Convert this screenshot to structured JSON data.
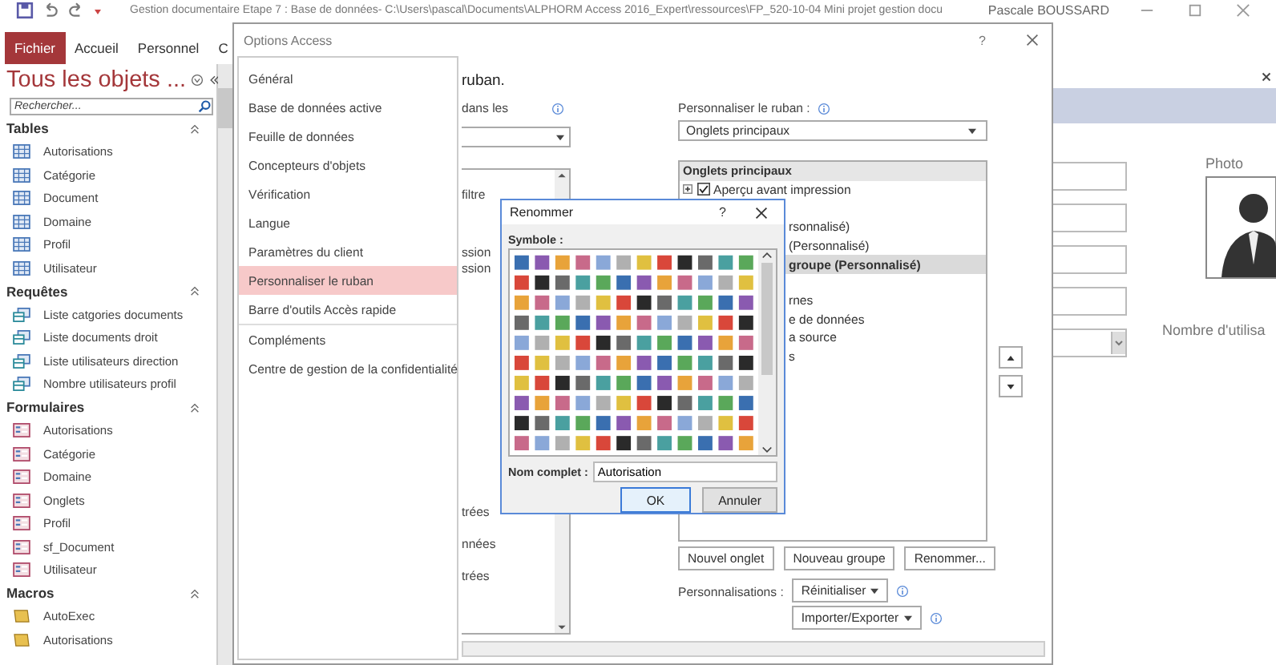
{
  "title_bar": {
    "title": "Gestion documentaire Etape 7 : Base de données- C:\\Users\\pascal\\Documents\\ALPHORM Access 2016_Expert\\ressources\\FP_520-10-04 Mini projet gestion docu",
    "user": "Pascale BOUSSARD"
  },
  "ribbon_tabs": [
    {
      "label": "Fichier",
      "selected": true
    },
    {
      "label": "Accueil",
      "selected": false
    },
    {
      "label": "Personnel",
      "selected": false
    },
    {
      "label": "C",
      "selected": false
    }
  ],
  "navigation": {
    "title": "Tous les objets ...",
    "search": {
      "placeholder": "Rechercher..."
    },
    "groups": [
      {
        "label": "Tables",
        "kind": "table",
        "items": [
          "Autorisations",
          "Catégorie",
          "Document",
          "Domaine",
          "Profil",
          "Utilisateur"
        ]
      },
      {
        "label": "Requêtes",
        "kind": "query",
        "items": [
          "Liste catgories documents",
          "Liste documents droit",
          "Liste utilisateurs direction",
          "Nombre utilisateurs profil"
        ]
      },
      {
        "label": "Formulaires",
        "kind": "form",
        "items": [
          "Autorisations",
          "Catégorie",
          "Domaine",
          "Onglets",
          "Profil",
          "sf_Document",
          "Utilisateur"
        ]
      },
      {
        "label": "Macros",
        "kind": "macro",
        "items": [
          "AutoExec",
          "Autorisations"
        ]
      }
    ]
  },
  "form": {
    "photo_label": "Photo",
    "count_label": "Nombre d'utilisa"
  },
  "options_dialog": {
    "title": "Options Access",
    "help": "?",
    "categories": [
      {
        "label": "Général",
        "selected": false
      },
      {
        "label": "Base de données active",
        "selected": false
      },
      {
        "label": "Feuille de données",
        "selected": false
      },
      {
        "label": "Concepteurs d'objets",
        "selected": false
      },
      {
        "label": "Vérification",
        "selected": false
      },
      {
        "label": "Langue",
        "selected": false
      },
      {
        "label": "Paramètres du client",
        "selected": false
      },
      {
        "label": "Personnaliser le ruban",
        "selected": true
      },
      {
        "label": "Barre d'outils Accès rapide",
        "selected": false
      },
      {
        "label": "Compléments",
        "selected": false
      },
      {
        "label": "Centre de gestion de la confidentialité",
        "selected": false
      }
    ],
    "heading": "ruban.",
    "left_label": "dans les",
    "left_list_groups": [
      {
        "items": [
          "filtre"
        ]
      },
      {
        "items": [
          "ssion",
          "ssion"
        ]
      },
      {
        "items": [
          "trées",
          "nnées",
          "trées"
        ]
      }
    ],
    "ribbon_label": "Personnaliser le ruban :",
    "ribbon_select": "Onglets principaux",
    "tree": [
      {
        "kind": "header",
        "label": "Onglets principaux",
        "selected": false
      },
      {
        "kind": "tab",
        "label": "Aperçu avant impression",
        "checked": true,
        "selected": false
      },
      {
        "kind": "fragment",
        "label": "rsonnalisé)",
        "selected": false
      },
      {
        "kind": "fragment",
        "label": "(Personnalisé)",
        "selected": false
      },
      {
        "kind": "fragment",
        "label": "groupe (Personnalisé)",
        "selected": true
      },
      {
        "kind": "fragment",
        "label": "rnes",
        "selected": false
      },
      {
        "kind": "fragment",
        "label": "e de données",
        "selected": false
      },
      {
        "kind": "fragment",
        "label": "a source",
        "selected": false
      },
      {
        "kind": "fragment",
        "label": "s",
        "selected": false
      }
    ],
    "tree_buttons": [
      "Nouvel onglet",
      "Nouveau groupe",
      "Renommer..."
    ],
    "customizations_label": "Personnalisations :",
    "reset_button": "Réinitialiser",
    "import_button": "Importer/Exporter"
  },
  "rename_dialog": {
    "title": "Renommer",
    "help": "?",
    "symbol_label": "Symbole :",
    "name_label": "Nom complet :",
    "name_value": "Autorisation",
    "buttons": [
      {
        "label": "OK",
        "default": true
      },
      {
        "label": "Annuler",
        "default": false
      }
    ]
  }
}
